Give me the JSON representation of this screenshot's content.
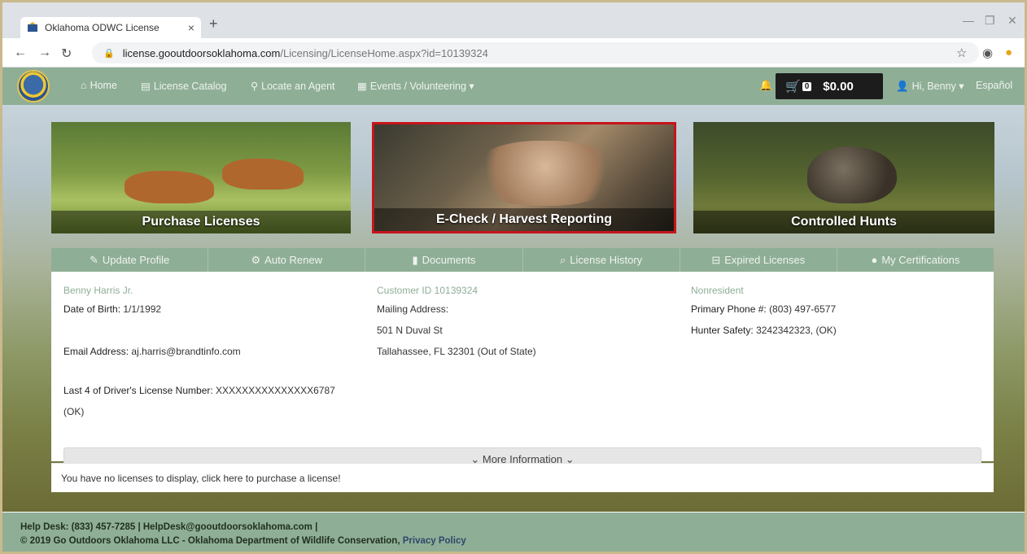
{
  "browser": {
    "tab_title": "Oklahoma ODWC License",
    "tab_close": "×",
    "new_tab": "+",
    "url_host": "license.gooutdoorsoklahoma.com",
    "url_path": "/Licensing/LicenseHome.aspx?id=10139324"
  },
  "nav": {
    "home": "Home",
    "catalog": "License Catalog",
    "agent": "Locate an Agent",
    "events": "Events / Volunteering ▾",
    "cart_count": "0",
    "cart_total": "$0.00",
    "user": "Hi, Benny ▾",
    "language": "Español"
  },
  "tiles": {
    "purchase": "Purchase Licenses",
    "echeck": "E-Check / Harvest Reporting",
    "hunts": "Controlled Hunts"
  },
  "profile_tabs": [
    {
      "label": "Update Profile",
      "icon": "✎"
    },
    {
      "label": "Auto Renew",
      "icon": "⚙"
    },
    {
      "label": "Documents",
      "icon": "▮"
    },
    {
      "label": "License History",
      "icon": "⌕"
    },
    {
      "label": "Expired Licenses",
      "icon": "⊟"
    },
    {
      "label": "My Certifications",
      "icon": "●"
    }
  ],
  "profile": {
    "name": "Benny Harris Jr.",
    "dob_label": "Date of Birth:",
    "dob": "1/1/1992",
    "email_label": "Email Address:",
    "email": "aj.harris@brandtinfo.com",
    "dl_label": "Last 4 of Driver's License Number:",
    "dl": "XXXXXXXXXXXXXXX6787",
    "dl_state": "(OK)",
    "customer_id": "Customer ID 10139324",
    "mailing_label": "Mailing Address:",
    "address1": "501 N Duval St",
    "address2": "Tallahassee, FL 32301 (Out of State)",
    "residency": "Nonresident",
    "phone_label": "Primary Phone #:",
    "phone": "(803) 497-6577",
    "safety_label": "Hunter Safety:",
    "safety": "3242342323, (OK)"
  },
  "more_info": "More Information",
  "no_licenses": "You have no licenses to display, click here to purchase a license!",
  "footer": {
    "line1": "Help Desk: (833) 457-7285 | HelpDesk@gooutdoorsoklahoma.com |",
    "line2": "© 2019 Go Outdoors Oklahoma LLC - Oklahoma Department of Wildlife Conservation,",
    "privacy": "Privacy  Policy"
  },
  "colors": {
    "nav_green": "#8fae96",
    "highlight_red": "#c7141b",
    "cart_black": "#1c1c1c"
  }
}
